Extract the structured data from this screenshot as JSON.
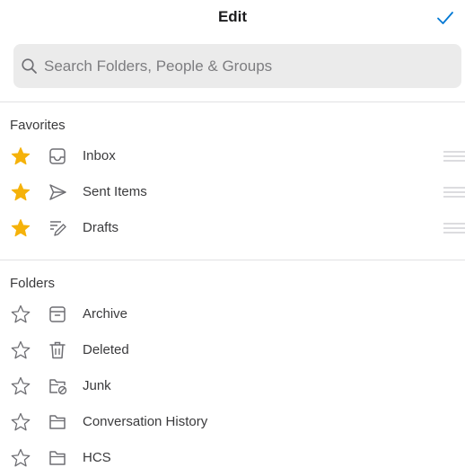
{
  "header": {
    "title": "Edit",
    "done_icon": "checkmark-icon"
  },
  "search": {
    "placeholder": "Search Folders, People & Groups",
    "icon": "search-icon"
  },
  "favorites": {
    "title": "Favorites",
    "items": [
      {
        "label": "Inbox",
        "icon": "inbox-icon",
        "starred": true
      },
      {
        "label": "Sent Items",
        "icon": "send-icon",
        "starred": true
      },
      {
        "label": "Drafts",
        "icon": "drafts-pencil-icon",
        "starred": true
      }
    ]
  },
  "folders": {
    "title": "Folders",
    "items": [
      {
        "label": "Archive",
        "icon": "archive-icon",
        "starred": false
      },
      {
        "label": "Deleted",
        "icon": "trash-icon",
        "starred": false
      },
      {
        "label": "Junk",
        "icon": "junk-folder-icon",
        "starred": false
      },
      {
        "label": "Conversation History",
        "icon": "folder-icon",
        "starred": false
      },
      {
        "label": "HCS",
        "icon": "folder-icon",
        "starred": false
      }
    ]
  },
  "colors": {
    "accent": "#0078d4",
    "star": "#f5b20a",
    "text": "#3a3a3c",
    "icon": "#6e6e73"
  }
}
